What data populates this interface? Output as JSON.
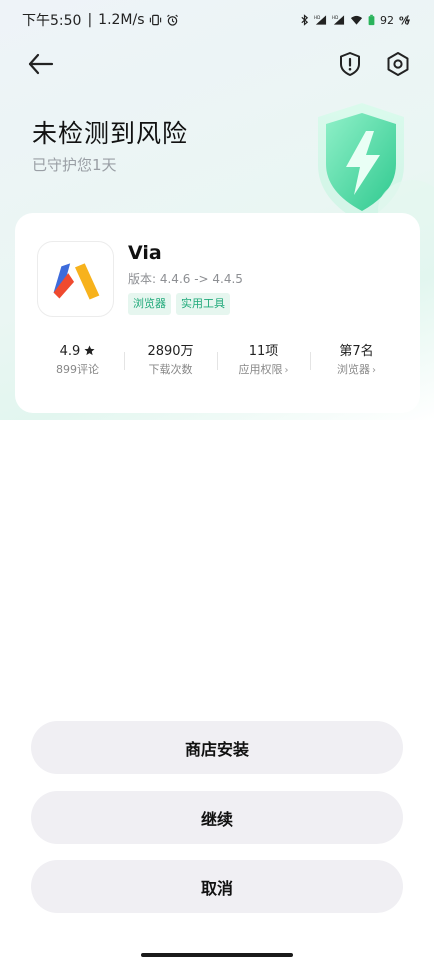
{
  "status_bar": {
    "time": "下午5:50",
    "separator": "|",
    "network_speed": "1.2M/s",
    "battery": "92",
    "icons": [
      "vibrate-icon",
      "alarm-icon",
      "bluetooth-icon",
      "signal-hd-icon",
      "signal-hd-icon",
      "wifi-icon",
      "battery-icon",
      "charging-icon"
    ]
  },
  "nav": {
    "icons": [
      "back-arrow-icon",
      "shield-alert-icon",
      "settings-hexagon-icon"
    ]
  },
  "header": {
    "title": "未检测到风险",
    "subtitle": "已守护您1天"
  },
  "app": {
    "name": "Via",
    "version": "版本: 4.4.6 -> 4.4.5",
    "tags": [
      "浏览器",
      "实用工具"
    ],
    "stats": [
      {
        "value": "4.9",
        "label": "899评论"
      },
      {
        "value": "2890万",
        "label": "下载次数"
      },
      {
        "value": "11项",
        "label": "应用权限"
      },
      {
        "value": "第7名",
        "label": "浏览器"
      }
    ]
  },
  "buttons": {
    "store_install": "商店安装",
    "continue": "继续",
    "cancel": "取消"
  },
  "colors": {
    "accent_green": "#20a97a",
    "tag_bg": "#e6f6ef",
    "button_bg": "#f0eff3"
  }
}
